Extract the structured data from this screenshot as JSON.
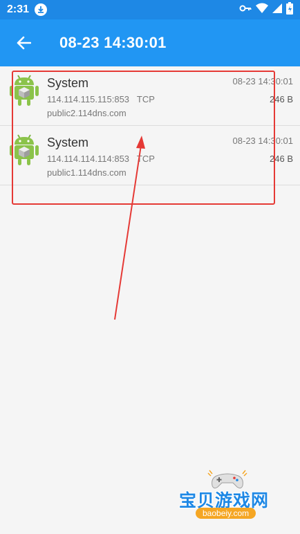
{
  "status_bar": {
    "time": "2:31",
    "icons": [
      "download-icon",
      "vpn-key-icon",
      "wifi-icon",
      "signal-icon",
      "battery-icon"
    ]
  },
  "app_bar": {
    "title": "08-23 14:30:01"
  },
  "connections": [
    {
      "app": "System",
      "address": "114.114.115.115:853",
      "protocol": "TCP",
      "host": "public2.114dns.com",
      "time": "08-23 14:30:01",
      "size": "246 B"
    },
    {
      "app": "System",
      "address": "114.114.114.114:853",
      "protocol": "TCP",
      "host": "public1.114dns.com",
      "time": "08-23 14:30:01",
      "size": "246 B"
    }
  ],
  "watermark": {
    "name": "宝贝游戏网",
    "site": "baobeiy.com"
  },
  "colors": {
    "app_bar": "#2196f3",
    "status_bar": "#1e88e5",
    "annotation": "#e53935",
    "android_green": "#8bc34a"
  }
}
